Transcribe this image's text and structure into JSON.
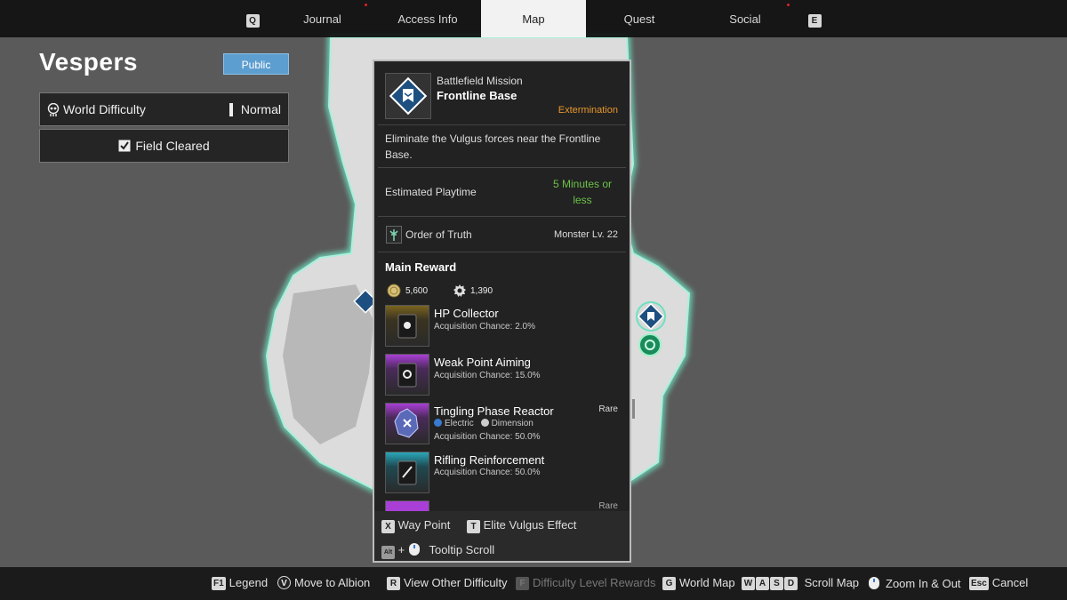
{
  "tabs": [
    {
      "label": "Journal"
    },
    {
      "label": "Access Info"
    },
    {
      "label": "Map"
    },
    {
      "label": "Quest"
    },
    {
      "label": "Social"
    }
  ],
  "tab_keys": {
    "left": "Q",
    "right": "E"
  },
  "region": {
    "name": "Vespers",
    "visibility": "Public",
    "difficulty_label": "World Difficulty",
    "difficulty_value": "Normal",
    "field_status": "Field Cleared"
  },
  "mission": {
    "type": "Battlefield Mission",
    "name": "Frontline Base",
    "category": "Extermination",
    "description": "Eliminate the Vulgus forces near the Frontline Base.",
    "playtime_label": "Estimated Playtime",
    "playtime_value": "5 Minutes or less",
    "faction": "Order of Truth",
    "monster_level": "Monster Lv. 22",
    "reward_title": "Main Reward",
    "gold": "5,600",
    "exp": "1,390",
    "rewards": [
      {
        "name": "HP Collector",
        "chance": "Acquisition Chance: 2.0%",
        "tag": ""
      },
      {
        "name": "Weak Point Aiming",
        "chance": "Acquisition Chance: 15.0%",
        "tag": ""
      },
      {
        "name": "Tingling Phase Reactor",
        "attr1": "Electric",
        "attr2": "Dimension",
        "chance": "Acquisition Chance: 50.0%",
        "tag": "Rare"
      },
      {
        "name": "Rifling Reinforcement",
        "chance": "Acquisition Chance: 50.0%",
        "tag": ""
      }
    ],
    "next_tag": "Rare"
  },
  "panel_keys": {
    "waypoint_key": "X",
    "waypoint_label": "Way Point",
    "elite_key": "T",
    "elite_label": "Elite Vulgus Effect",
    "scroll_alt": "Alt",
    "scroll_plus": "+",
    "scroll_label": "Tooltip Scroll"
  },
  "hints": {
    "legend_key": "F1",
    "legend": "Legend",
    "albion_key": "V",
    "albion": "Move to Albion",
    "other_key": "R",
    "other": "View Other Difficulty",
    "rewards_key": "F",
    "rewards": "Difficulty Level Rewards",
    "worldmap_key": "G",
    "worldmap": "World Map",
    "scroll_keys": [
      "W",
      "A",
      "S",
      "D"
    ],
    "scroll": "Scroll Map",
    "zoom": "Zoom In & Out",
    "cancel_key": "Esc",
    "cancel": "Cancel"
  },
  "colors": {
    "accent_orange": "#e8962e",
    "accent_green": "#6cc24a",
    "public_blue": "#5d9ed0",
    "map_glow": "#6fe0c0",
    "rarity_purple": "#a93fd6",
    "rarity_gold": "#b8952e",
    "rarity_teal": "#2aa6b8"
  },
  "icons": {
    "mission": "mission-flag-icon",
    "faction": "order-of-truth-icon",
    "gold": "gold-coin-icon",
    "exp": "exp-gear-icon",
    "difficulty": "skull-icon",
    "field": "checkbox-icon",
    "zoom": "mouse-icon"
  }
}
